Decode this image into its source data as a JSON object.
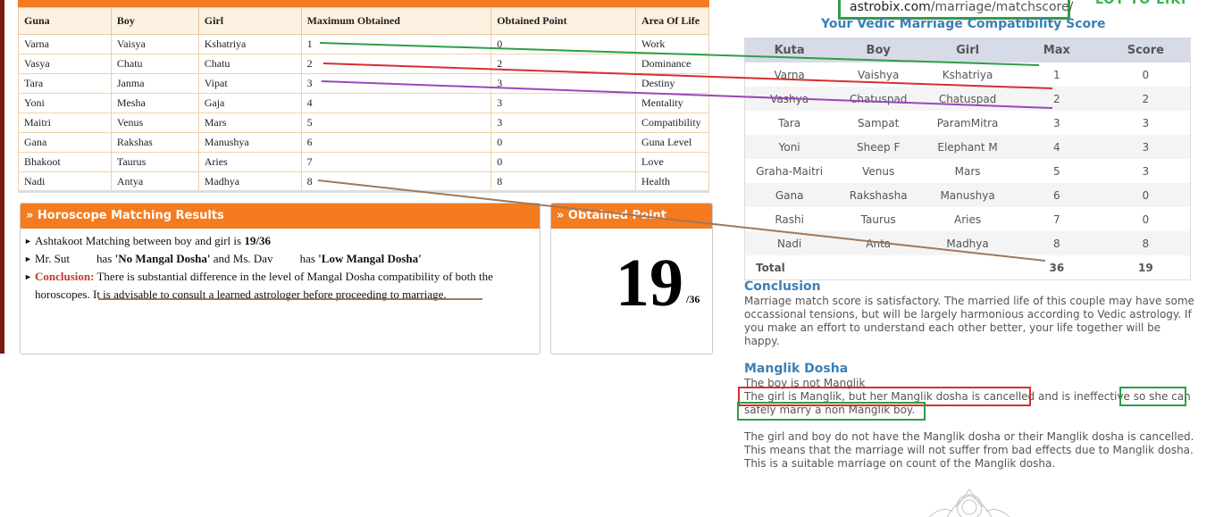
{
  "left_table": {
    "headers": [
      "Guna",
      "Boy",
      "Girl",
      "Maximum Obtained",
      "Obtained Point",
      "Area Of Life"
    ],
    "rows": [
      [
        "Varna",
        "Vaisya",
        "Kshatriya",
        "1",
        "0",
        "Work"
      ],
      [
        "Vasya",
        "Chatu",
        "Chatu",
        "2",
        "2",
        "Dominance"
      ],
      [
        "Tara",
        "Janma",
        "Vipat",
        "3",
        "3",
        "Destiny"
      ],
      [
        "Yoni",
        "Mesha",
        "Gaja",
        "4",
        "3",
        "Mentality"
      ],
      [
        "Maitri",
        "Venus",
        "Mars",
        "5",
        "3",
        "Compatibility"
      ],
      [
        "Gana",
        "Rakshas",
        "Manushya",
        "6",
        "0",
        "Guna Level"
      ],
      [
        "Bhakoot",
        "Taurus",
        "Aries",
        "7",
        "0",
        "Love"
      ],
      [
        "Nadi",
        "Antya",
        "Madhya",
        "8",
        "8",
        "Health"
      ]
    ]
  },
  "results": {
    "header": "» Horoscope Matching Results",
    "line1_text": "Ashtakoot Matching between boy and girl is ",
    "line1_score": "19/36",
    "line2_a": "Mr. Sut",
    "line2_b": "has ",
    "line2_boy_dosha": "'No Mangal Dosha'",
    "line2_c": " and Ms. Dav",
    "line2_d": "has ",
    "line2_girl_dosha": "'Low Mangal Dosha'",
    "conclusion_label": "Conclusion:",
    "conclusion_text": " There is substantial difference in the level of Mangal Dosha compatibility of both the horoscopes. It is advisable to consult a learned astrologer before proceeding to marriage."
  },
  "obtained": {
    "header": "» Obtained Point",
    "score": "19",
    "total": "/36"
  },
  "url": {
    "domain": "astrobix.com",
    "path": "/marriage/matchscore/"
  },
  "top_right_fragment": "LOT TO LIKI",
  "right_title": "Your Vedic Marriage Compatibility Score",
  "kuta_table": {
    "headers": [
      "Kuta",
      "Boy",
      "Girl",
      "Max",
      "Score"
    ],
    "rows": [
      [
        "Varna",
        "Vaishya",
        "Kshatriya",
        "1",
        "0"
      ],
      [
        "Vashya",
        "Chatuspad",
        "Chatuspad",
        "2",
        "2"
      ],
      [
        "Tara",
        "Sampat",
        "ParamMitra",
        "3",
        "3"
      ],
      [
        "Yoni",
        "Sheep F",
        "Elephant M",
        "4",
        "3"
      ],
      [
        "Graha-Maitri",
        "Venus",
        "Mars",
        "5",
        "3"
      ],
      [
        "Gana",
        "Rakshasha",
        "Manushya",
        "6",
        "0"
      ],
      [
        "Rashi",
        "Taurus",
        "Aries",
        "7",
        "0"
      ],
      [
        "Nadi",
        "Anta",
        "Madhya",
        "8",
        "8"
      ]
    ],
    "total_label": "Total",
    "total_max": "36",
    "total_score": "19"
  },
  "conclusion": {
    "title": "Conclusion",
    "text": "Marriage match score is satisfactory. The married life of this couple may have some occassional tensions, but will be largely harmonious according to Vedic astrology. If you make an effort to understand each other better, your life together will be happy."
  },
  "manglik": {
    "title": "Manglik Dosha",
    "line1": "The boy is not Manglik",
    "line2_a": "The girl is Manglik, but her Manglik dosha is cancelled",
    "line2_b": " and is ineffective ",
    "line2_c": "so she can",
    "line3": "safely marry a non Manglik boy.",
    "para2": "The girl and boy do not have the Manglik dosha or their Manglik dosha is cancelled. This means that the marriage will not suffer from bad effects due to Manglik dosha. This is a suitable marriage on count of the Manglik dosha."
  },
  "colors": {
    "orange": "#f47b20",
    "accent_blue": "#3b7fb6",
    "green": "#2f9e44",
    "red": "#d62f2f",
    "purple": "#9b47b8",
    "brown": "#a0785a"
  }
}
